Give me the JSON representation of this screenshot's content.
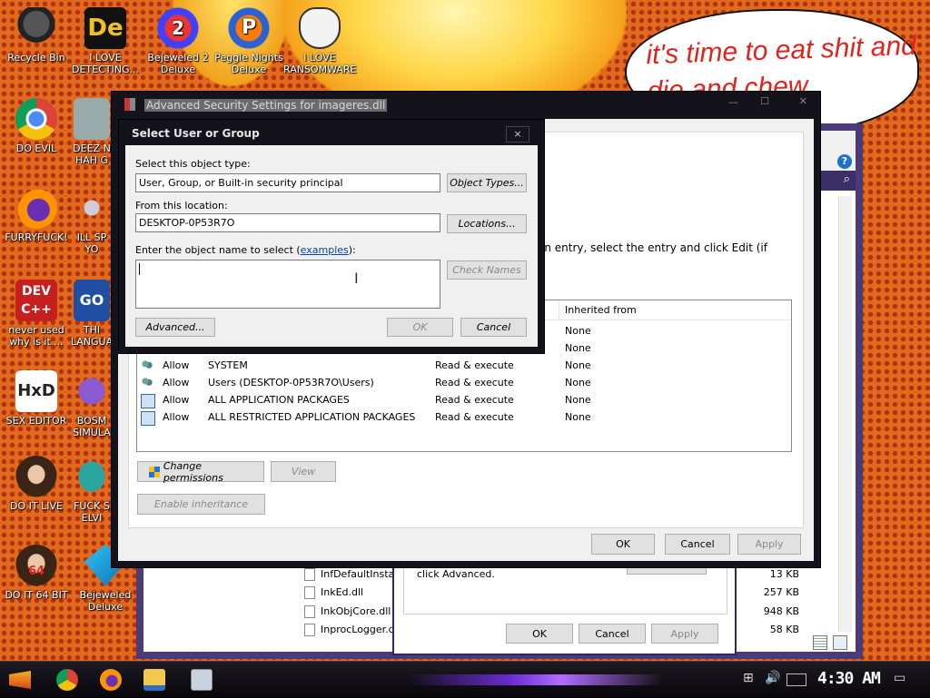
{
  "desktop": {
    "speech_bubble": "it's time to eat shit and die and chew",
    "icons": [
      {
        "label": "Recycle Bin"
      },
      {
        "label": "I LOVE DETECTING..."
      },
      {
        "label": "Bejeweled 2 Deluxe"
      },
      {
        "label": "Peggle Nights Deluxe"
      },
      {
        "label": "I LOVE RANSOMWARE"
      },
      {
        "label": "DO EVIL"
      },
      {
        "label": "DEEZ N HAH G"
      },
      {
        "label": "FURRYFUCK!"
      },
      {
        "label": "ILL SP YO"
      },
      {
        "label": "never used why is it ..."
      },
      {
        "label": "THI LANGUA"
      },
      {
        "label": "SEX EDITOR"
      },
      {
        "label": "BOSM SIMULA"
      },
      {
        "label": "DO IT LIVE"
      },
      {
        "label": "FUCK S ELVI"
      },
      {
        "label": "DO IT 64 BIT"
      },
      {
        "label": "Bejeweled Deluxe"
      }
    ],
    "icon_text": {
      "devcpp": "DEV C++",
      "hxd": "HxD",
      "go": "GO",
      "de": "De",
      "peggle": "P",
      "bej2": "2",
      "dit64": "64"
    }
  },
  "adv_window": {
    "title": "Advanced Security Settings for imageres.dll",
    "instructions": "on entry, select the entry and click Edit (if",
    "columns": {
      "inherited": "Inherited from"
    },
    "rows": [
      {
        "type": "",
        "principal": "",
        "access": "",
        "inherited": "None"
      },
      {
        "type": "",
        "principal": "",
        "access": "",
        "inherited": "None"
      },
      {
        "type": "Allow",
        "principal": "SYSTEM",
        "access": "Read & execute",
        "inherited": "None"
      },
      {
        "type": "Allow",
        "principal": "Users (DESKTOP-0P53R7O\\Users)",
        "access": "Read & execute",
        "inherited": "None"
      },
      {
        "type": "Allow",
        "principal": "ALL APPLICATION PACKAGES",
        "access": "Read & execute",
        "inherited": "None"
      },
      {
        "type": "Allow",
        "principal": "ALL RESTRICTED APPLICATION PACKAGES",
        "access": "Read & execute",
        "inherited": "None"
      }
    ],
    "change_permissions": "Change permissions",
    "view": "View",
    "enable_inheritance": "Enable inheritance",
    "ok": "OK",
    "cancel": "Cancel",
    "apply": "Apply"
  },
  "dialog": {
    "title": "Select User or Group",
    "close": "×",
    "object_type_label": "Select this object type:",
    "object_type_value": "User, Group, or Built-in security principal",
    "object_types_button": "Object Types...",
    "location_label": "From this location:",
    "location_value": "DESKTOP-0P53R7O",
    "locations_button": "Locations...",
    "enter_name_label": "Enter the object name to select (",
    "examples_link": "examples",
    "enter_name_suffix": "):",
    "check_names": "Check Names",
    "advanced": "Advanced...",
    "ok": "OK",
    "cancel": "Cancel"
  },
  "back_window": {
    "files": [
      {
        "name": "InfDefaultInstall",
        "size": "13 KB"
      },
      {
        "name": "InkEd.dll",
        "size": "257 KB"
      },
      {
        "name": "InkObjCore.dll",
        "size": "948 KB"
      },
      {
        "name": "InprocLogger.d",
        "size": "58 KB"
      }
    ],
    "sub_text": "click Advanced.",
    "sub_ok": "OK",
    "sub_cancel": "Cancel",
    "sub_apply": "Apply",
    "help": "?"
  },
  "taskbar": {
    "clock": "4:30 AM"
  }
}
